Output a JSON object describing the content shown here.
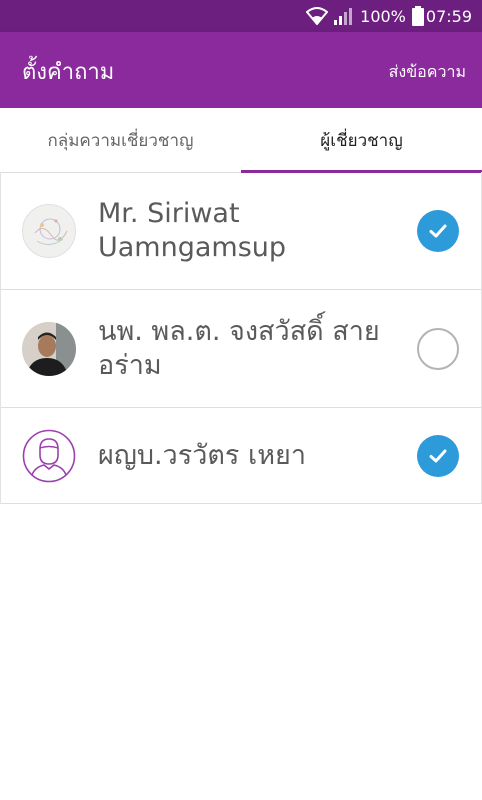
{
  "status_bar": {
    "battery_percent": "100%",
    "time": "07:59"
  },
  "header": {
    "title": "ตั้งคำถาม",
    "action_label": "ส่งข้อความ"
  },
  "tabs": [
    {
      "label": "กลุ่มความเชี่ยวชาญ",
      "active": false
    },
    {
      "label": "ผู้เชี่ยวชาญ",
      "active": true
    }
  ],
  "experts": [
    {
      "name": "Mr. Siriwat Uamngamsup",
      "selected": true,
      "avatar_icon": "doodle-avatar"
    },
    {
      "name": "นพ. พล.ต. จงสวัสดิ์ สายอร่าม",
      "selected": false,
      "avatar_icon": "photo-avatar"
    },
    {
      "name": "ผญบ.วรวัตร เหยา",
      "selected": true,
      "avatar_icon": "default-person-avatar"
    }
  ],
  "colors": {
    "status_bar": "#6d1f80",
    "app_bar": "#8b2a9d",
    "accent": "#8b2a9d",
    "check_selected": "#2d9ad9"
  }
}
